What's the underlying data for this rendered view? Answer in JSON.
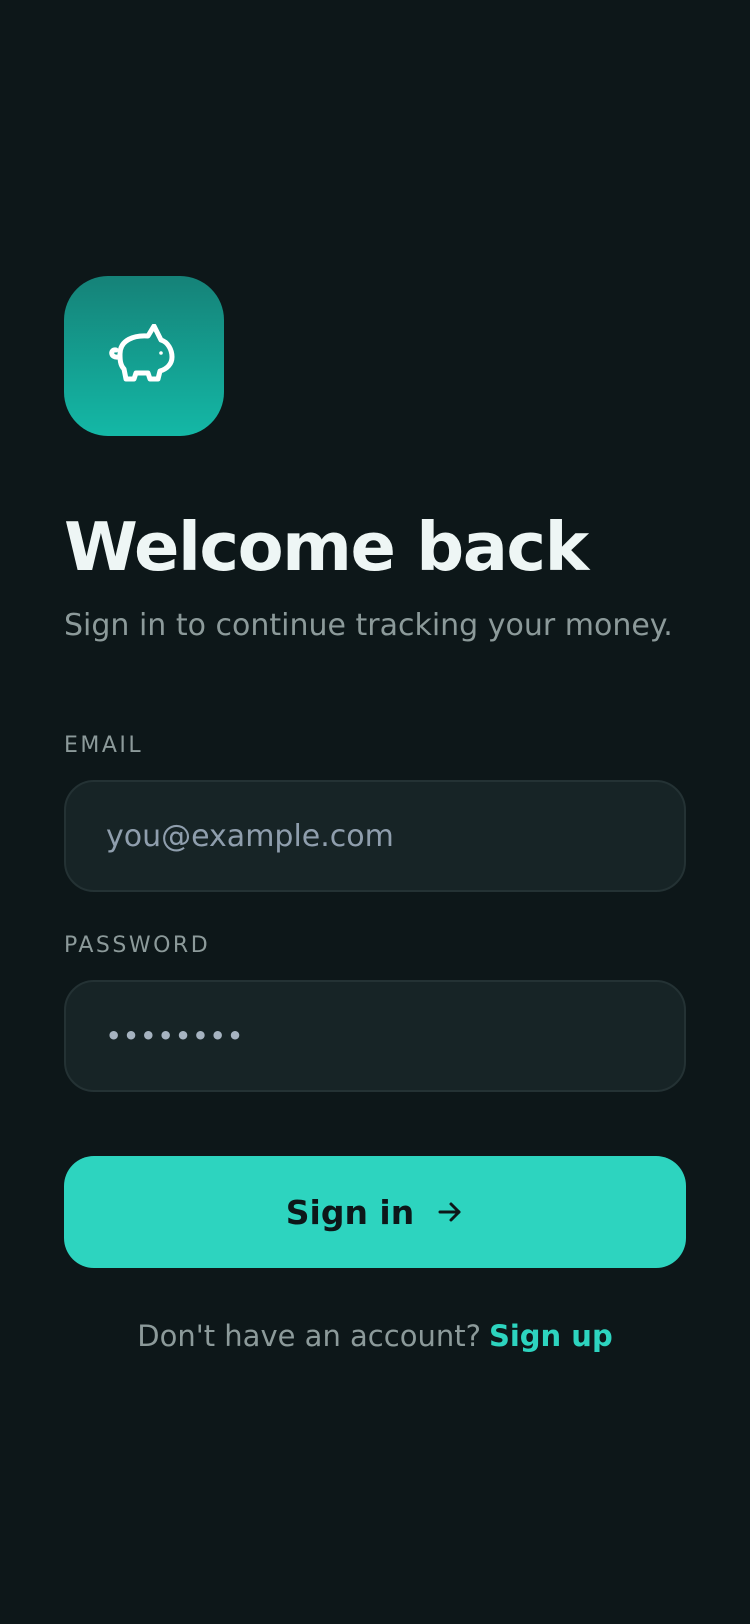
{
  "brand": {
    "logo_icon": "piggy-bank-icon",
    "logo_gradient": [
      "#158278",
      "#14b8a6"
    ],
    "accent": "#2dd4bf",
    "background": "#0d1719"
  },
  "header": {
    "title": "Welcome back",
    "subtitle": "Sign in to continue tracking your money."
  },
  "form": {
    "email": {
      "label": "EMAIL",
      "placeholder": "you@example.com",
      "value": ""
    },
    "password": {
      "label": "PASSWORD",
      "value": "••••••••"
    },
    "submit": {
      "label": "Sign in",
      "icon": "arrow-right-icon"
    }
  },
  "footer": {
    "prompt": "Don't have an account?",
    "link_label": "Sign up"
  }
}
